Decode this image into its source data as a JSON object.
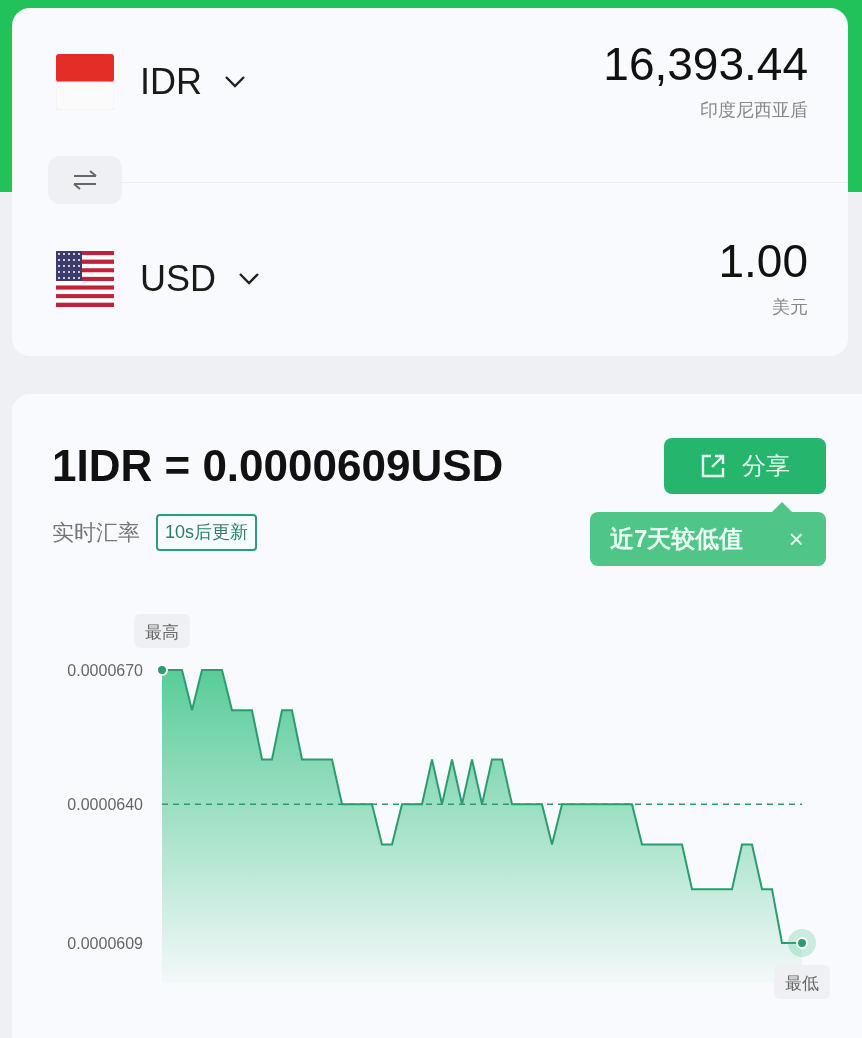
{
  "converter": {
    "rows": [
      {
        "code": "IDR",
        "amount": "16,393.44",
        "name": "印度尼西亚盾"
      },
      {
        "code": "USD",
        "amount": "1.00",
        "name": "美元"
      }
    ]
  },
  "rate": {
    "title": "1IDR = 0.0000609USD",
    "subtitle": "实时汇率",
    "refresh_badge": "10s后更新",
    "share_button": "分享",
    "tip": {
      "text": "近7天较低值",
      "close": "×"
    },
    "chart_data": {
      "type": "area",
      "ylim": [
        6.09e-05,
        6.7e-05
      ],
      "yticks": [
        {
          "value": 6.7e-05,
          "label": "0.0000670"
        },
        {
          "value": 6.4e-05,
          "label": "0.0000640"
        },
        {
          "value": 6.09e-05,
          "label": "0.0000609"
        }
      ],
      "series": [
        {
          "color": "#2a9d6e",
          "values": [
            6.7e-05,
            6.7e-05,
            6.7e-05,
            6.61e-05,
            6.7e-05,
            6.7e-05,
            6.7e-05,
            6.61e-05,
            6.61e-05,
            6.61e-05,
            6.5e-05,
            6.5e-05,
            6.61e-05,
            6.61e-05,
            6.5e-05,
            6.5e-05,
            6.5e-05,
            6.5e-05,
            6.4e-05,
            6.4e-05,
            6.4e-05,
            6.4e-05,
            6.31e-05,
            6.31e-05,
            6.4e-05,
            6.4e-05,
            6.4e-05,
            6.5e-05,
            6.4e-05,
            6.5e-05,
            6.4e-05,
            6.5e-05,
            6.4e-05,
            6.5e-05,
            6.5e-05,
            6.4e-05,
            6.4e-05,
            6.4e-05,
            6.4e-05,
            6.31e-05,
            6.4e-05,
            6.4e-05,
            6.4e-05,
            6.4e-05,
            6.4e-05,
            6.4e-05,
            6.4e-05,
            6.4e-05,
            6.31e-05,
            6.31e-05,
            6.31e-05,
            6.31e-05,
            6.31e-05,
            6.21e-05,
            6.21e-05,
            6.21e-05,
            6.21e-05,
            6.21e-05,
            6.31e-05,
            6.31e-05,
            6.21e-05,
            6.21e-05,
            6.09e-05,
            6.09e-05,
            6.09e-05
          ]
        },
        {
          "type": "line",
          "line_style": "dashed",
          "color": "#2a9d6e",
          "values": [
            6.4e-05,
            6.4e-05,
            6.4e-05,
            6.4e-05,
            6.4e-05,
            6.4e-05,
            6.4e-05,
            6.4e-05,
            6.4e-05,
            6.4e-05,
            6.4e-05,
            6.4e-05,
            6.4e-05,
            6.4e-05,
            6.4e-05,
            6.4e-05,
            6.4e-05,
            6.4e-05,
            6.4e-05,
            6.4e-05,
            6.4e-05,
            6.4e-05,
            6.4e-05,
            6.4e-05,
            6.4e-05,
            6.4e-05,
            6.4e-05,
            6.4e-05,
            6.4e-05,
            6.4e-05,
            6.4e-05,
            6.4e-05,
            6.4e-05,
            6.4e-05,
            6.4e-05,
            6.4e-05,
            6.4e-05,
            6.4e-05,
            6.4e-05,
            6.4e-05,
            6.4e-05,
            6.4e-05,
            6.4e-05,
            6.4e-05,
            6.4e-05,
            6.4e-05,
            6.4e-05,
            6.4e-05,
            6.4e-05,
            6.4e-05,
            6.4e-05,
            6.4e-05,
            6.4e-05,
            6.4e-05,
            6.4e-05,
            6.4e-05,
            6.4e-05,
            6.4e-05,
            6.4e-05,
            6.4e-05,
            6.4e-05,
            6.4e-05,
            6.4e-05,
            6.4e-05,
            6.4e-05
          ]
        }
      ],
      "annotations": [
        {
          "text": "最高",
          "y": 6.7e-05
        },
        {
          "text": "最低",
          "y": 6.09e-05
        }
      ]
    }
  }
}
